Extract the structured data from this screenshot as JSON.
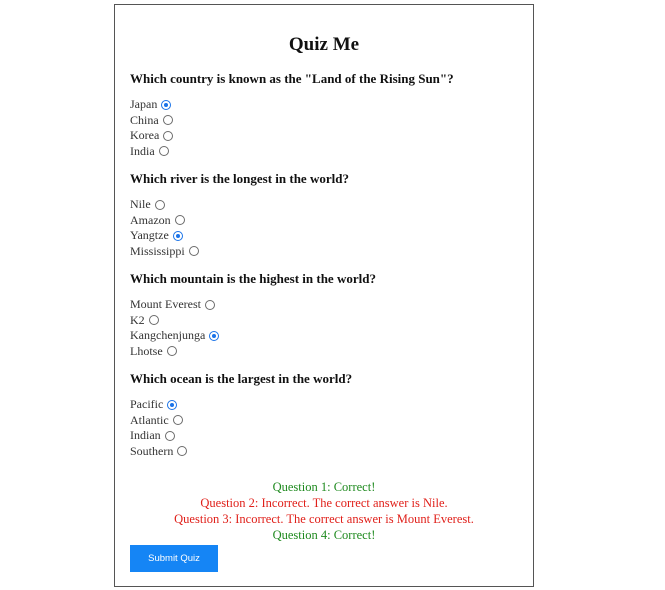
{
  "quiz": {
    "title": "Quiz Me",
    "submit_label": "Submit Quiz",
    "accent_color": "#1585f5"
  },
  "questions": [
    {
      "text": "Which country is known as the \"Land of the Rising Sun\"?",
      "options": [
        {
          "label": "Japan",
          "checked": true
        },
        {
          "label": "China",
          "checked": false
        },
        {
          "label": "Korea",
          "checked": false
        },
        {
          "label": "India",
          "checked": false
        }
      ]
    },
    {
      "text": "Which river is the longest in the world?",
      "options": [
        {
          "label": "Nile",
          "checked": false
        },
        {
          "label": "Amazon",
          "checked": false
        },
        {
          "label": "Yangtze",
          "checked": true
        },
        {
          "label": "Mississippi",
          "checked": false
        }
      ]
    },
    {
      "text": "Which mountain is the highest in the world?",
      "options": [
        {
          "label": "Mount Everest",
          "checked": false
        },
        {
          "label": "K2",
          "checked": false
        },
        {
          "label": "Kangchenjunga",
          "checked": true
        },
        {
          "label": "Lhotse",
          "checked": false
        }
      ]
    },
    {
      "text": "Which ocean is the largest in the world?",
      "options": [
        {
          "label": "Pacific",
          "checked": true
        },
        {
          "label": "Atlantic",
          "checked": false
        },
        {
          "label": "Indian",
          "checked": false
        },
        {
          "label": "Southern",
          "checked": false
        }
      ]
    }
  ],
  "results": [
    {
      "text": "Question 1: Correct!",
      "status": "correct"
    },
    {
      "text": "Question 2: Incorrect. The correct answer is Nile.",
      "status": "incorrect"
    },
    {
      "text": "Question 3: Incorrect. The correct answer is Mount Everest.",
      "status": "incorrect"
    },
    {
      "text": "Question 4: Correct!",
      "status": "correct"
    }
  ],
  "colors": {
    "correct": "#1f8a1f",
    "incorrect": "#e0201a",
    "radio_checked": "#1a73e8"
  }
}
